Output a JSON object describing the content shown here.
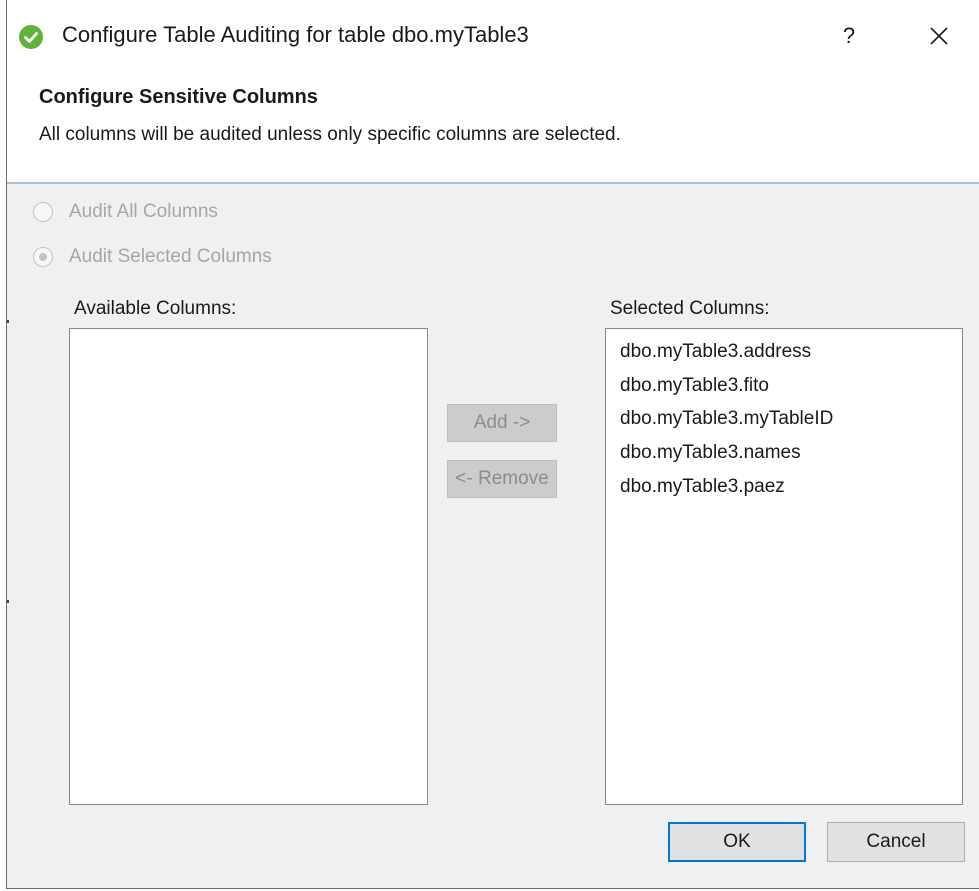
{
  "window": {
    "title": "Configure Table Auditing for table dbo.myTable3",
    "help_label": "?",
    "icon": "green-check-icon",
    "close_icon": "close-icon"
  },
  "header": {
    "title": "Configure Sensitive Columns",
    "description": "All columns will be audited unless only specific columns are selected."
  },
  "audit_options": [
    {
      "label": "Audit All Columns",
      "checked": false,
      "enabled": false
    },
    {
      "label": "Audit Selected Columns",
      "checked": true,
      "enabled": false
    }
  ],
  "available": {
    "label": "Available Columns:",
    "items": []
  },
  "selected": {
    "label": "Selected Columns:",
    "items": [
      "dbo.myTable3.address",
      "dbo.myTable3.fito",
      "dbo.myTable3.myTableID",
      "dbo.myTable3.names",
      "dbo.myTable3.paez"
    ]
  },
  "transfer_buttons": {
    "add_label": "Add ->",
    "remove_label": "<- Remove",
    "enabled": false
  },
  "footer": {
    "ok_label": "OK",
    "cancel_label": "Cancel"
  },
  "colors": {
    "accent": "#0078d7",
    "icon_green": "#5fb336",
    "separator": "#a8bfd6"
  }
}
